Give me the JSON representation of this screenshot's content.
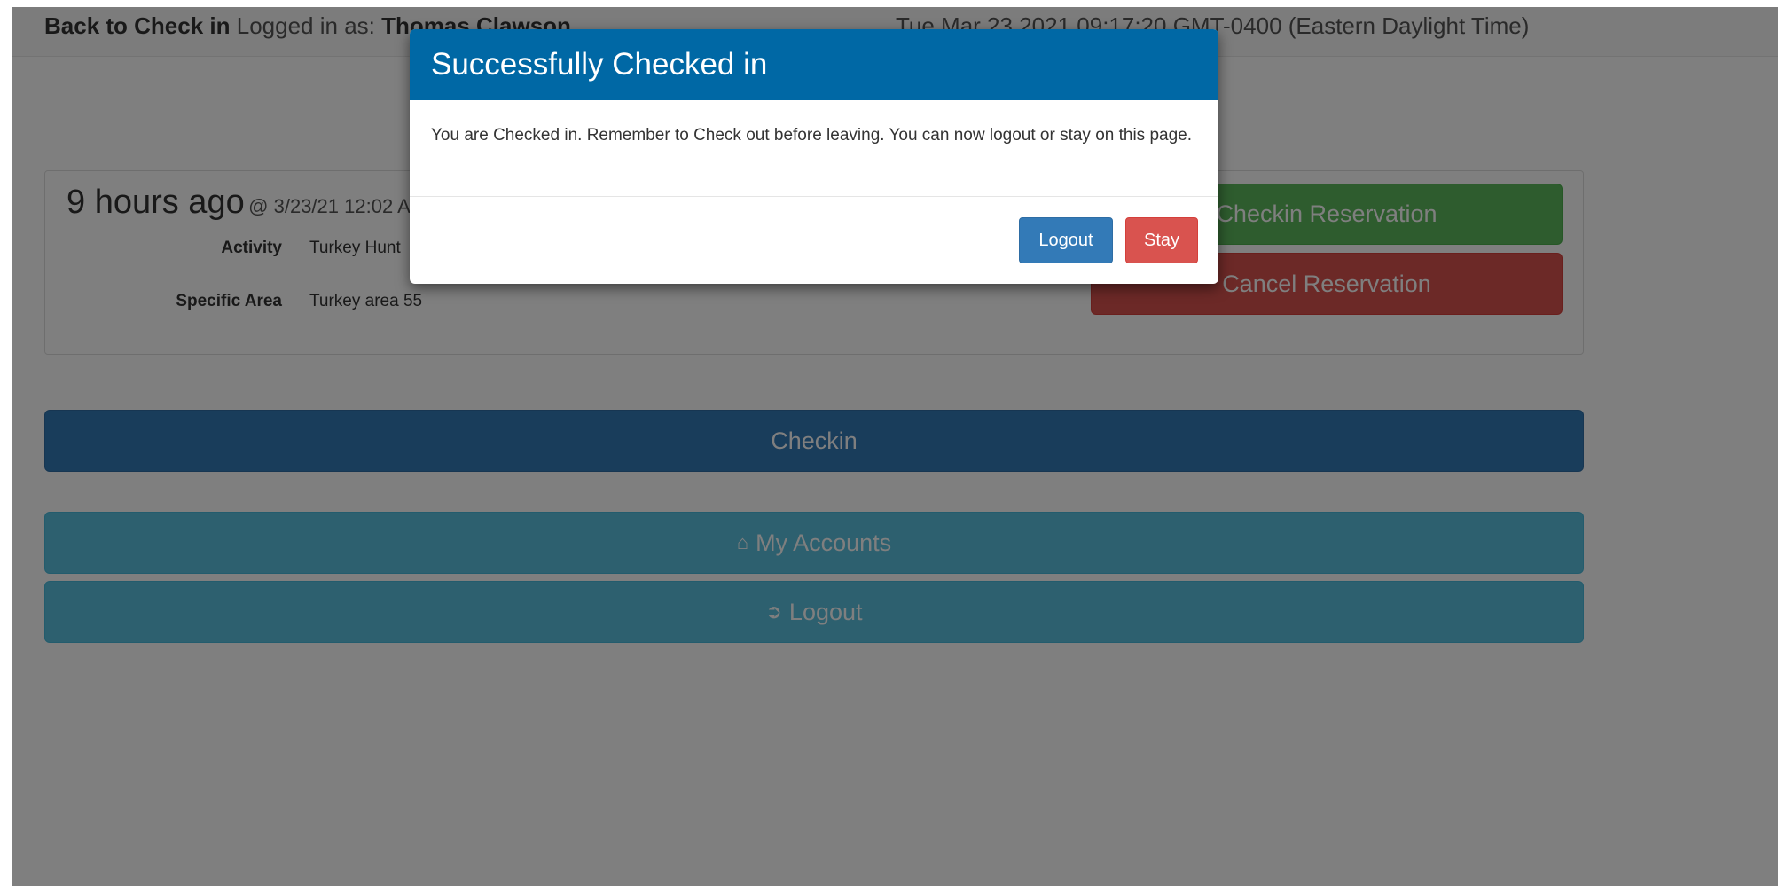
{
  "topbar": {
    "back_link": "Back to Check in",
    "logged_in_prefix": "Logged in as:",
    "user_name": "Thomas Clawson",
    "datetime": "Tue Mar 23 2021 09:17:20 GMT-0400 (Eastern Daylight Time)"
  },
  "reservation": {
    "relative_time": "9 hours ago",
    "timestamp": "@ 3/23/21 12:02 AM",
    "activity_label": "Activity",
    "activity_value": "Turkey Hunt",
    "area_label": "Specific Area",
    "area_value": "Turkey area 55",
    "checkin_button": "Checkin Reservation",
    "cancel_button": "Cancel Reservation"
  },
  "actions": {
    "checkin": "Checkin",
    "my_accounts": "My Accounts",
    "logout": "Logout",
    "my_accounts_icon": "home-icon",
    "logout_icon": "sign-out-icon"
  },
  "modal": {
    "title": "Successfully Checked in",
    "message": "You are Checked in. Remember to Check out before leaving. You can now logout or stay on this page.",
    "logout_button": "Logout",
    "stay_button": "Stay"
  }
}
